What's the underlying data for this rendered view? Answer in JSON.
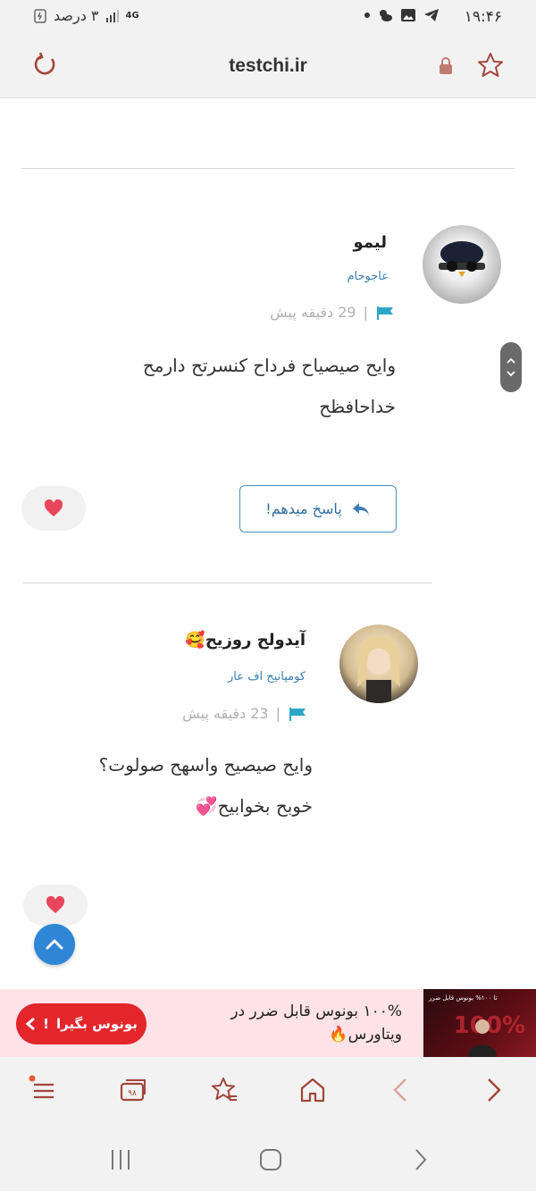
{
  "status_bar": {
    "time": "۱۹:۴۶",
    "battery_text": "۳ درصد",
    "network": "4G"
  },
  "browser": {
    "url": "testchi.ir"
  },
  "comments": [
    {
      "name": "لیمو",
      "group": "عاجوحام",
      "time_ago": "29 دقیقه پیش",
      "lines": [
        "وایح صیصیاح فرداح کنسرتح دارمح",
        "خداحافظح"
      ],
      "reply_label": "پاسخ میدهم!"
    },
    {
      "name": "آیدولح روزیح🥰",
      "group": "کومپانیح اف عار",
      "time_ago": "23 دقیقه پیش",
      "lines": [
        "وایح صیصیح واسهح صولوت؟",
        "خوبح بخوابیح💞"
      ]
    }
  ],
  "ad": {
    "text": "۱۰۰% بونوس قابل ضرر در ویتاورس🔥",
    "button_label": "بونوس بگیرا",
    "image_pct": "100%",
    "image_caption": "تا ۱۰۰% بونوس قابل ضرر"
  },
  "colors": {
    "accent": "#a2453b",
    "link": "#3b7fb0",
    "fab": "#2f86d6",
    "ad_bg": "#fde3e8",
    "ad_btn": "#e3262b"
  }
}
